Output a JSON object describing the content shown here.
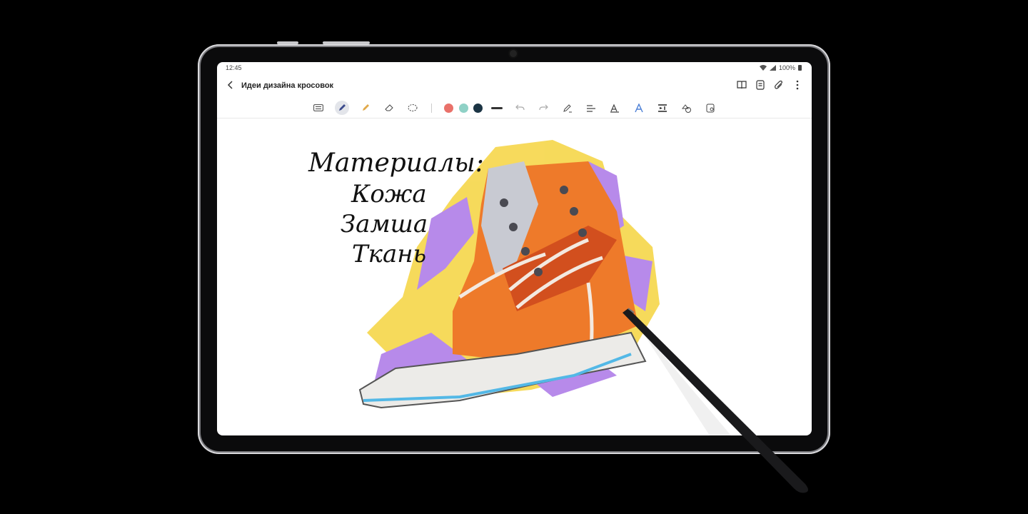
{
  "status_bar": {
    "time": "12:45",
    "battery": "100%"
  },
  "app": {
    "title": "Идеи дизайна кросовок"
  },
  "toolbar": {
    "tools": [
      "keyboard-icon",
      "pen-icon",
      "highlighter-icon",
      "eraser-icon",
      "lasso-icon"
    ],
    "colors": [
      "#e9716a",
      "#8fd1c6",
      "#1b3444"
    ],
    "actions": [
      "undo-icon",
      "redo-icon",
      "pen-to-text-icon",
      "straighten-icon",
      "text-style-icon",
      "ai-assist-icon",
      "insert-text-icon",
      "shapes-icon",
      "lock-icon"
    ]
  },
  "note": {
    "handwriting": [
      "Материалы:",
      "Кожа",
      "Замша",
      "Ткань"
    ]
  },
  "colors": {
    "screen_bg": "#ffffff",
    "bezel": "#0b0b0c",
    "accent_active": "#e3e5ea"
  }
}
